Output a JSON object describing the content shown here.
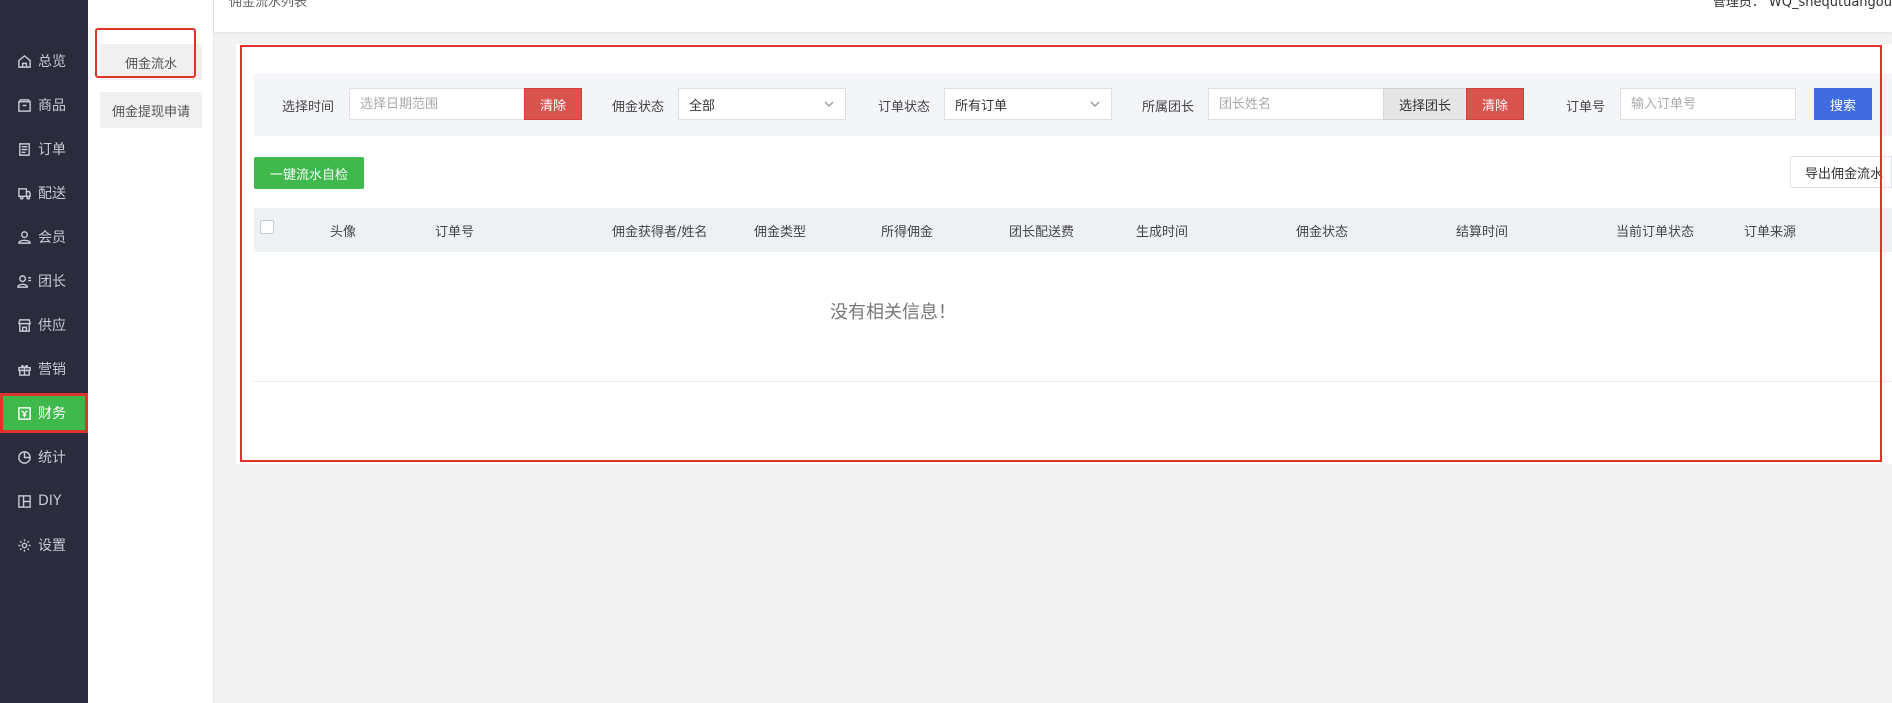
{
  "nav": {
    "items": [
      {
        "label": "总览",
        "icon": "home-icon"
      },
      {
        "label": "商品",
        "icon": "box-icon"
      },
      {
        "label": "订单",
        "icon": "order-icon"
      },
      {
        "label": "配送",
        "icon": "delivery-icon"
      },
      {
        "label": "会员",
        "icon": "user-icon"
      },
      {
        "label": "团长",
        "icon": "leader-icon"
      },
      {
        "label": "供应",
        "icon": "shop-icon"
      },
      {
        "label": "营销",
        "icon": "gift-icon"
      },
      {
        "label": "财务",
        "icon": "finance-icon"
      },
      {
        "label": "统计",
        "icon": "pie-chart-icon"
      },
      {
        "label": "DIY",
        "icon": "layout-icon"
      },
      {
        "label": "设置",
        "icon": "gear-icon"
      }
    ],
    "active_index": 8,
    "active_color": "#3fb84c"
  },
  "subnav": {
    "items": [
      {
        "label": "佣金流水"
      },
      {
        "label": "佣金提现申请"
      }
    ]
  },
  "header": {
    "breadcrumb": "佣金流水列表",
    "admin": "管理员： WQ_shequtuangou"
  },
  "filters": {
    "time_label": "选择时间",
    "time_placeholder": "选择日期范围",
    "clear_label": "清除",
    "commission_status_label": "佣金状态",
    "commission_status_value": "全部",
    "order_status_label": "订单状态",
    "order_status_value": "所有订单",
    "leader_label": "所属团长",
    "leader_placeholder": "团长姓名",
    "select_leader_label": "选择团长",
    "order_no_label": "订单号",
    "order_no_placeholder": "输入订单号",
    "search_label": "搜索"
  },
  "actions": {
    "self_check_label": "一键流水自检",
    "export_label": "导出佣金流水"
  },
  "table": {
    "columns": [
      "头像",
      "订单号",
      "佣金获得者/姓名",
      "佣金类型",
      "所得佣金",
      "团长配送费",
      "生成时间",
      "佣金状态",
      "结算时间",
      "当前订单状态",
      "订单来源"
    ],
    "empty_text": "没有相关信息！"
  },
  "colors": {
    "danger": "#d9534f",
    "primary": "#3f6de1",
    "success": "#3fb84c",
    "highlight": "#e0332b"
  }
}
